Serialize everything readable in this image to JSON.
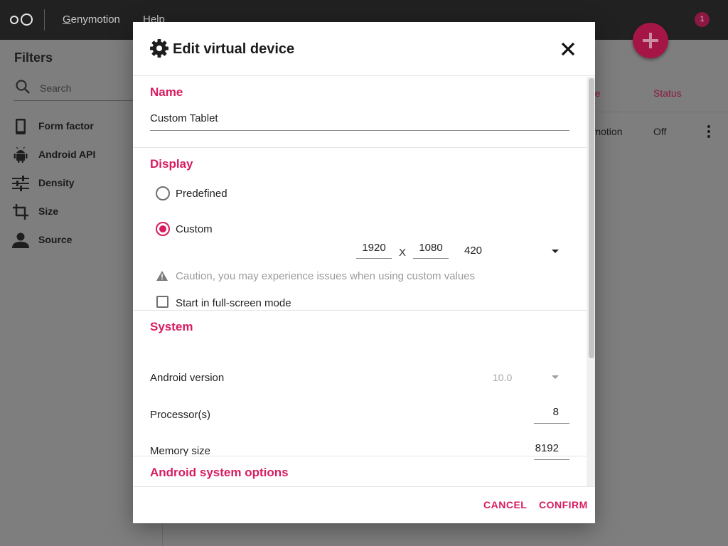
{
  "app": {
    "menu": {
      "genymotion": "Genymotion",
      "help": "Help"
    },
    "notifications_count": "1",
    "accent_color": "#d81b60"
  },
  "sidebar": {
    "title": "Filters",
    "search_placeholder": "Search",
    "items": [
      {
        "label": "Form factor",
        "icon": "phone-icon"
      },
      {
        "label": "Android API",
        "icon": "android-icon"
      },
      {
        "label": "Density",
        "icon": "sliders-icon"
      },
      {
        "label": "Size",
        "icon": "crop-icon"
      },
      {
        "label": "Source",
        "icon": "person-icon"
      }
    ]
  },
  "table": {
    "headers": {
      "source": "Source",
      "status": "Status"
    },
    "rows": [
      {
        "source": "Genymotion",
        "status": "Off"
      }
    ]
  },
  "dialog": {
    "title": "Edit virtual device",
    "name": {
      "section": "Name",
      "value": "Custom Tablet"
    },
    "display": {
      "section": "Display",
      "predefined_label": "Predefined",
      "custom_label": "Custom",
      "selected": "custom",
      "width": "1920",
      "separator": "X",
      "height": "1080",
      "density": "420",
      "warning": "Caution, you may experience issues when using custom values",
      "fullscreen_label": "Start in full-screen mode",
      "fullscreen_checked": false
    },
    "system": {
      "section": "System",
      "android_version_label": "Android version",
      "android_version_value": "10.0",
      "processors_label": "Processor(s)",
      "processors_value": "8",
      "memory_label": "Memory size",
      "memory_value": "8192"
    },
    "android_options": {
      "section": "Android system options"
    },
    "buttons": {
      "cancel": "CANCEL",
      "confirm": "CONFIRM"
    }
  }
}
